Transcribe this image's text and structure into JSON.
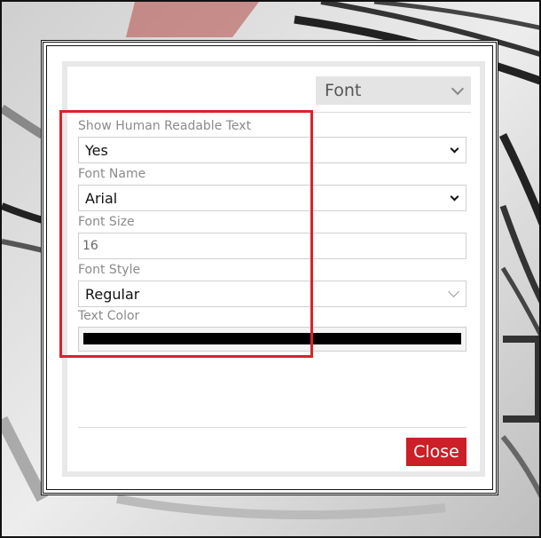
{
  "header": {
    "section_select": "Font"
  },
  "fields": {
    "show_human_readable": {
      "label": "Show Human Readable Text",
      "value": "Yes"
    },
    "font_name": {
      "label": "Font Name",
      "value": "Arial"
    },
    "font_size": {
      "label": "Font Size",
      "value": "16"
    },
    "font_style": {
      "label": "Font Style",
      "value": "Regular"
    },
    "text_color": {
      "label": "Text Color",
      "value": "#000000"
    }
  },
  "footer": {
    "close_label": "Close"
  },
  "colors": {
    "accent": "#cc1f27",
    "highlight": "#d8232a"
  }
}
